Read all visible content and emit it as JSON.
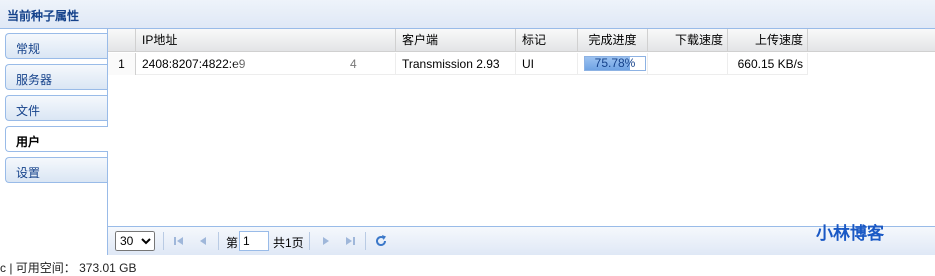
{
  "window": {
    "title": "当前种子属性"
  },
  "sidebar": {
    "items": [
      {
        "label": "常规",
        "active": false
      },
      {
        "label": "服务器",
        "active": false
      },
      {
        "label": "文件",
        "active": false
      },
      {
        "label": "用户",
        "active": true
      },
      {
        "label": "设置",
        "active": false
      }
    ]
  },
  "grid": {
    "columns": [
      "IP地址",
      "客户端",
      "标记",
      "完成进度",
      "下载速度",
      "上传速度"
    ],
    "rows": [
      {
        "index": "1",
        "ip": "2408:8207:4822:e9",
        "ip_tail": "4",
        "client": "Transmission 2.93",
        "flags": "UI",
        "progress": 0.7578,
        "progress_text": "75.78%",
        "download_speed": "",
        "upload_speed": "660.15 KB/s"
      }
    ]
  },
  "pager": {
    "page_size": "30",
    "page_size_options": [
      "30"
    ],
    "page_label": "第",
    "page_value": "1",
    "total_label": "共1页"
  },
  "watermark": "小林博客",
  "status_bar": "c | 可用空间： 373.01 GB",
  "colors": {
    "accent": "#15428b",
    "border": "#99bbe8",
    "progress": "#6fa3e4"
  }
}
